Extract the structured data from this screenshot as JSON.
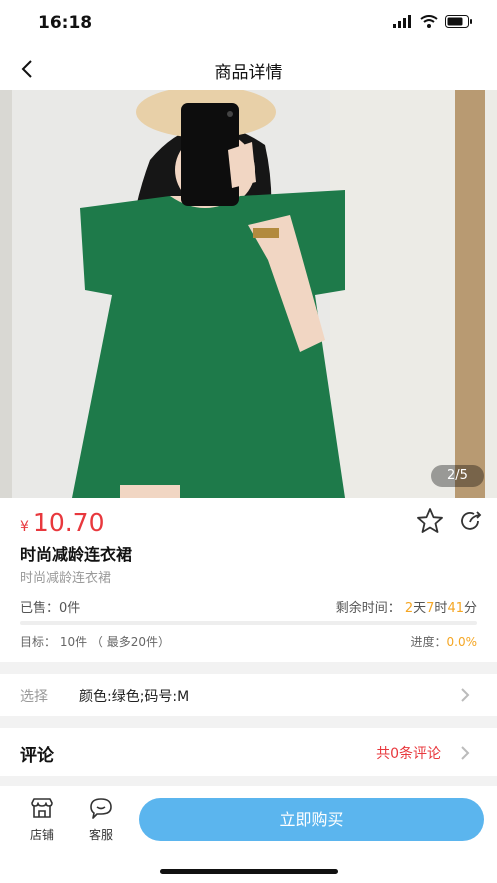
{
  "status_bar": {
    "time": "16:18"
  },
  "nav": {
    "title": "商品详情"
  },
  "gallery": {
    "counter": "2/5"
  },
  "product": {
    "currency": "¥",
    "price": "10.70",
    "title": "时尚减龄连衣裙",
    "subtitle": "时尚减龄连衣裙",
    "sold_label": "已售：",
    "sold_value": "0件",
    "remaining_label": "剩余时间：",
    "remaining_days": "2",
    "days_unit": "天",
    "remaining_hours": "7",
    "hours_unit": "时",
    "remaining_minutes": "41",
    "minutes_unit": "分",
    "progress_fraction": 0,
    "target_text": "目标：  10件 （ 最多20件）",
    "progress_label": "进度：",
    "progress_value": "0.0%"
  },
  "selection": {
    "label": "选择",
    "value": "颜色:绿色;码号:M"
  },
  "reviews": {
    "title": "评论",
    "count_text": "共0条评论"
  },
  "bottom_bar": {
    "shop_label": "店铺",
    "service_label": "客服",
    "buy_label": "立即购买"
  },
  "colors": {
    "price_red": "#e8383d",
    "accent_orange": "#f5a623",
    "buy_blue": "#5bb5ee",
    "dress_green": "#1e7a4a"
  }
}
